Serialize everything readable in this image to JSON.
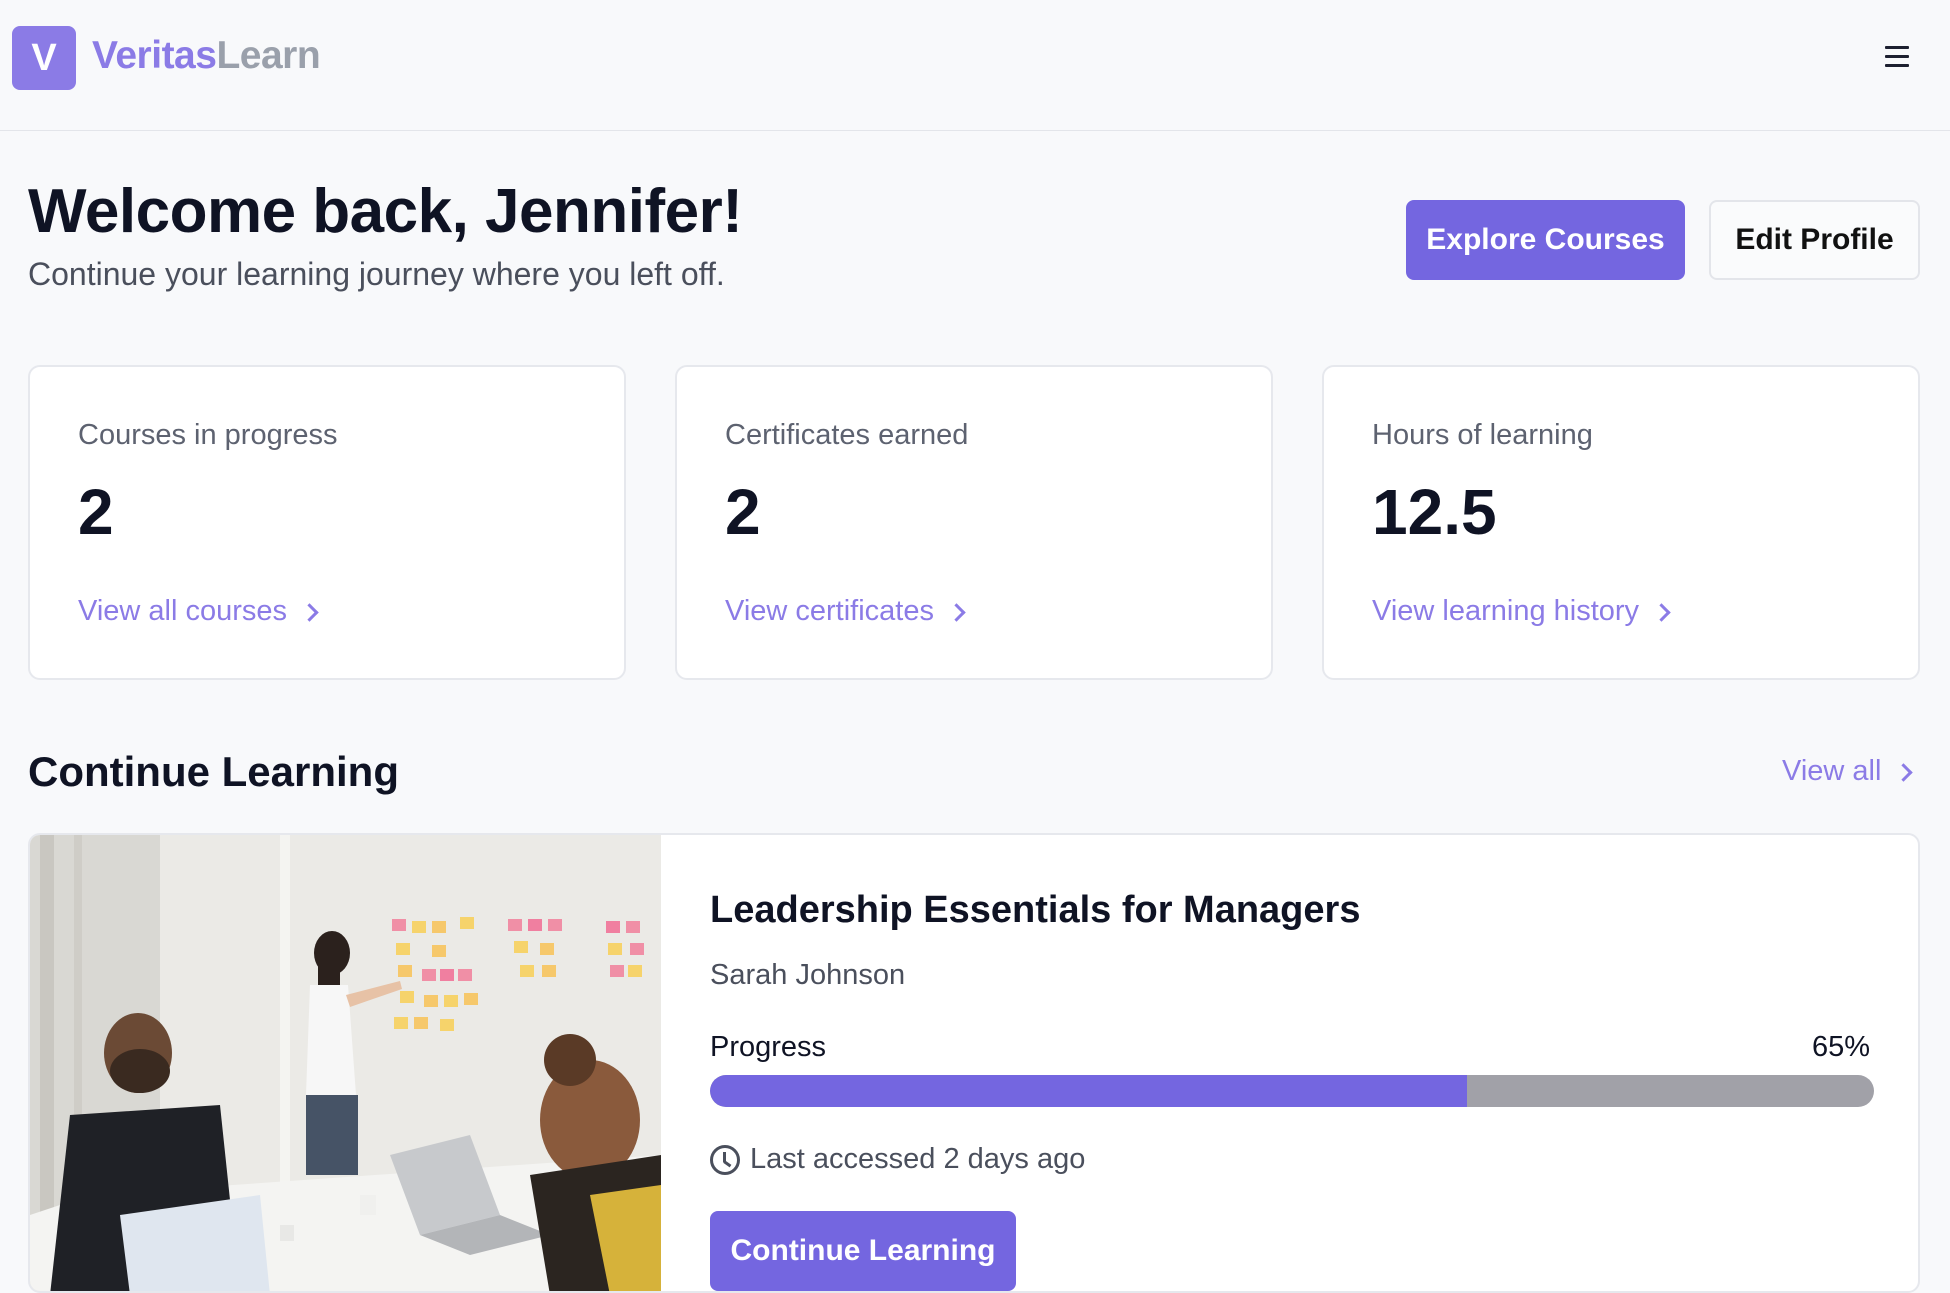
{
  "header": {
    "logo_letter": "V",
    "brand_part1": "Veritas",
    "brand_part2": "Learn",
    "menu_icon": "hamburger-menu-icon"
  },
  "welcome": {
    "title": "Welcome back, Jennifer!",
    "subtitle": "Continue your learning journey where you left off.",
    "explore_button": "Explore Courses",
    "edit_button": "Edit Profile"
  },
  "stats": [
    {
      "label": "Courses in progress",
      "value": "2",
      "link": "View all courses"
    },
    {
      "label": "Certificates earned",
      "value": "2",
      "link": "View certificates"
    },
    {
      "label": "Hours of learning",
      "value": "12.5",
      "link": "View learning history"
    }
  ],
  "continue_section": {
    "title": "Continue Learning",
    "view_all": "View all"
  },
  "course": {
    "title": "Leadership Essentials for Managers",
    "instructor": "Sarah Johnson",
    "progress_label": "Progress",
    "progress_text": "65%",
    "progress_value": 0.65,
    "last_accessed": "Last accessed 2 days ago",
    "button": "Continue Learning"
  },
  "colors": {
    "accent": "#7466e0",
    "accent_light": "#8b7be6"
  }
}
